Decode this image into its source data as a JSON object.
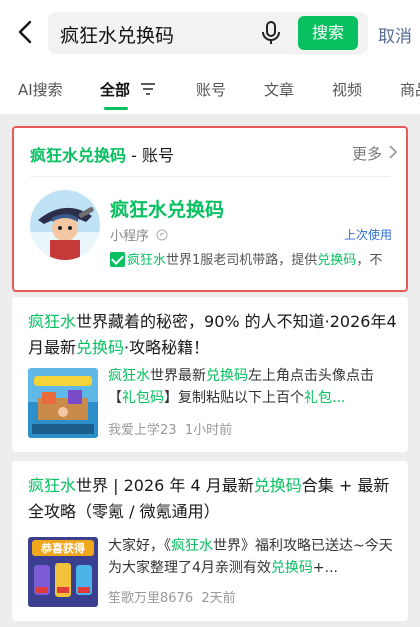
{
  "search": {
    "query": "疯狂水兑换码",
    "button": "搜索",
    "cancel": "取消"
  },
  "tabs": [
    "AI搜索",
    "全部",
    "账号",
    "文章",
    "视频",
    "商品"
  ],
  "active_tab": "全部",
  "colors": {
    "accent": "#07c160",
    "link": "#576b95",
    "highlight_border": "#e65a5a"
  },
  "account_card": {
    "header_green": "疯狂水兑换码",
    "header_rest": " - 账号",
    "more": "更多",
    "name": "疯狂水兑换码",
    "type": "小程序",
    "last_used": "上次使用",
    "desc_g1": "疯狂水",
    "desc_t1": "世界1服老司机带路，提供",
    "desc_g2": "兑换码",
    "desc_t2": "，不"
  },
  "articles": [
    {
      "title_parts": [
        {
          "t": "疯狂水",
          "g": true
        },
        {
          "t": "世界藏着的秘密，90% 的人不知道·2026年4月最新",
          "g": false
        },
        {
          "t": "兑换码",
          "g": true
        },
        {
          "t": "·攻略秘籍！",
          "g": false
        }
      ],
      "body_parts": [
        {
          "t": "疯狂水",
          "g": true
        },
        {
          "t": "世界最新",
          "g": false
        },
        {
          "t": "兑换码",
          "g": true
        },
        {
          "t": "左上角点击头像点击【",
          "g": false
        },
        {
          "t": "礼包码",
          "g": true
        },
        {
          "t": "】复制粘贴以下上百个",
          "g": false
        },
        {
          "t": "礼包...",
          "g": true
        }
      ],
      "author": "我爱上学23",
      "time": "1小时前"
    },
    {
      "title_parts": [
        {
          "t": "疯狂水",
          "g": true
        },
        {
          "t": "世界 | 2026 年 4 月最新",
          "g": false
        },
        {
          "t": "兑换码",
          "g": true
        },
        {
          "t": "合集 + 最新全攻略（零氪 / 微氪通用）",
          "g": false
        }
      ],
      "body_parts": [
        {
          "t": "大家好，《",
          "g": false
        },
        {
          "t": "疯狂水",
          "g": true
        },
        {
          "t": "世界》福利攻略已送达~今天为大家整理了4月亲测有效",
          "g": false
        },
        {
          "t": "兑换码",
          "g": true
        },
        {
          "t": "+...",
          "g": false
        }
      ],
      "author": "笙歌万里8676",
      "time": "2天前",
      "thumb_label": "恭喜获得"
    }
  ]
}
